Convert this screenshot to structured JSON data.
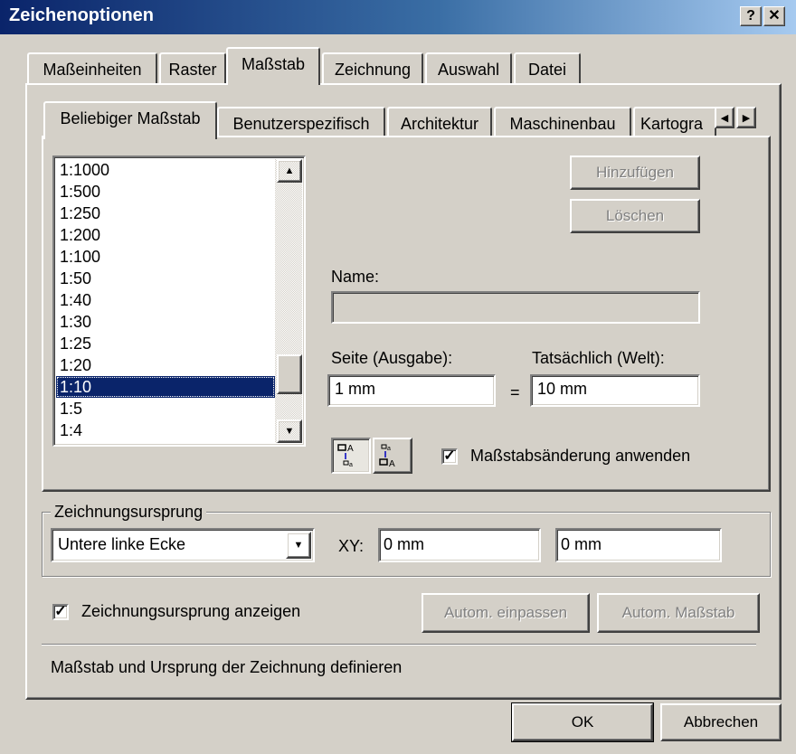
{
  "window": {
    "title": "Zeichenoptionen",
    "help_label": "?",
    "close_label": "✕"
  },
  "main_tabs": [
    "Maßeinheiten",
    "Raster",
    "Maßstab",
    "Zeichnung",
    "Auswahl",
    "Datei"
  ],
  "sub_tabs": [
    "Beliebiger Maßstab",
    "Benutzerspezifisch",
    "Architektur",
    "Maschinenbau",
    "Kartogra"
  ],
  "scale_list": {
    "items": [
      "1:1000",
      "1:500",
      "1:250",
      "1:200",
      "1:100",
      "1:50",
      "1:40",
      "1:30",
      "1:25",
      "1:20",
      "1:10",
      "1:5",
      "1:4"
    ],
    "selected": "1:10"
  },
  "buttons": {
    "add": "Hinzufügen",
    "delete": "Löschen",
    "autofit": "Autom. einpassen",
    "autoscale": "Autom. Maßstab",
    "ok": "OK",
    "cancel": "Abbrechen"
  },
  "name_label": "Name:",
  "name_value": "",
  "page_label": "Seite (Ausgabe):",
  "page_value": "1 mm",
  "equals": "=",
  "real_label": "Tatsächlich (Welt):",
  "real_value": "10 mm",
  "apply_scale": {
    "label": "Maßstabsänderung anwenden",
    "checked": true
  },
  "origin": {
    "group_label": "Zeichnungsursprung",
    "corner": "Untere linke Ecke",
    "xy_label": "XY:",
    "x_value": "0 mm",
    "y_value": "0 mm"
  },
  "show_origin": {
    "label": "Zeichnungsursprung anzeigen",
    "checked": true
  },
  "status_text": "Maßstab und Ursprung der Zeichnung definieren",
  "icons": {
    "swap_a": "scale-direction-icon",
    "swap_b": "scale-direction-reverse-icon"
  }
}
